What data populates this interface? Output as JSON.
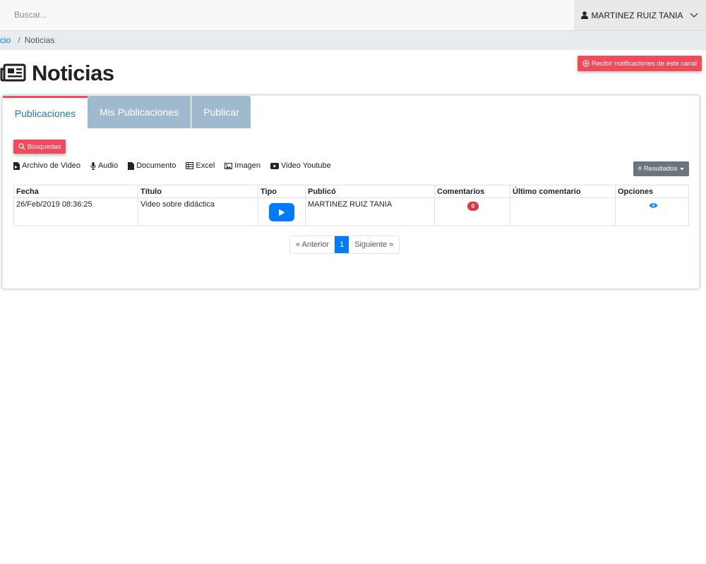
{
  "header": {
    "search_placeholder": "Buscar...",
    "user_name": "MARTINEZ RUIZ TANIA"
  },
  "breadcrumb": {
    "home": "cio",
    "separator": "/",
    "current": "Noticias"
  },
  "page": {
    "title": "Noticias",
    "notify_button": "Recibir notificaciones de este canal"
  },
  "tabs": [
    {
      "label": "Publicaciones",
      "active": true
    },
    {
      "label": "Mis Publicaciones",
      "active": false
    },
    {
      "label": "Publicar",
      "active": false
    }
  ],
  "search_button": "Búsquedas",
  "filters": [
    {
      "label": "Archivo de Video",
      "icon": "file-icon"
    },
    {
      "label": "Audio",
      "icon": "microphone-icon"
    },
    {
      "label": "Documento",
      "icon": "document-icon"
    },
    {
      "label": "Excel",
      "icon": "table-icon"
    },
    {
      "label": "Imagen",
      "icon": "image-icon"
    },
    {
      "label": "Video Youtube",
      "icon": "youtube-icon"
    }
  ],
  "results_button": "# Resultados",
  "table": {
    "headers": [
      "Fecha",
      "Título",
      "Tipo",
      "Publicó",
      "Comentarios",
      "Último comentario",
      "Opciones"
    ],
    "rows": [
      {
        "fecha": "26/Feb/2019 08:36:25",
        "titulo": "Video sobre didáctica",
        "tipo": "video-play-icon",
        "publico": "MARTINEZ RUIZ TANIA",
        "comentarios": "0",
        "ultimo": ""
      }
    ]
  },
  "pagination": {
    "prev": "« Anterior",
    "current": "1",
    "next": "Siguiente »"
  },
  "colors": {
    "accent_red": "#ef4b5a",
    "primary_blue": "#007bff",
    "tab_inactive": "#9fb9cf"
  }
}
